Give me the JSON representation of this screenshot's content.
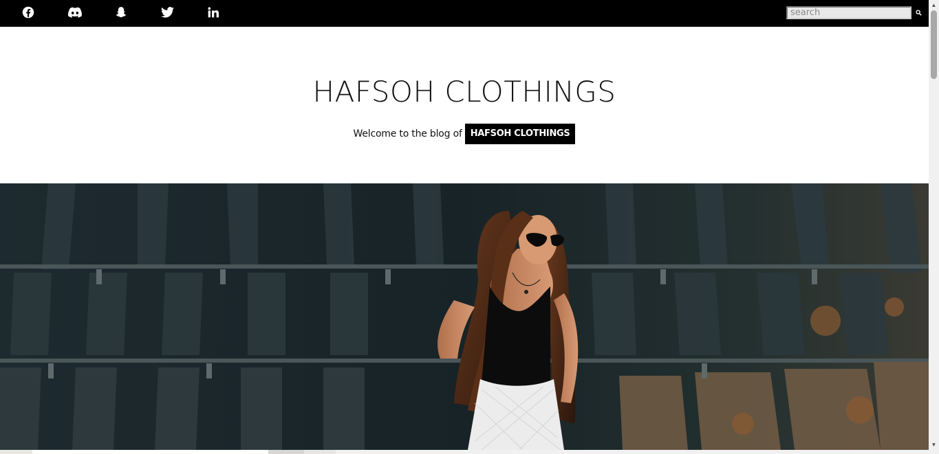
{
  "topbar": {
    "background": "#000000",
    "social_icons": [
      "facebook-icon",
      "discord-icon",
      "snapchat-icon",
      "twitter-icon",
      "linkedin-icon"
    ],
    "search": {
      "placeholder": "search",
      "value": "",
      "button_icon": "search-icon"
    }
  },
  "header": {
    "title": "HAFSOH CLOTHINGS",
    "tagline_text": "Welcome to the blog of",
    "tagline_badge": "HAFSOH CLOTHINGS"
  },
  "hero": {
    "image": "photo-woman-sunglasses-industrial-backdrop"
  }
}
